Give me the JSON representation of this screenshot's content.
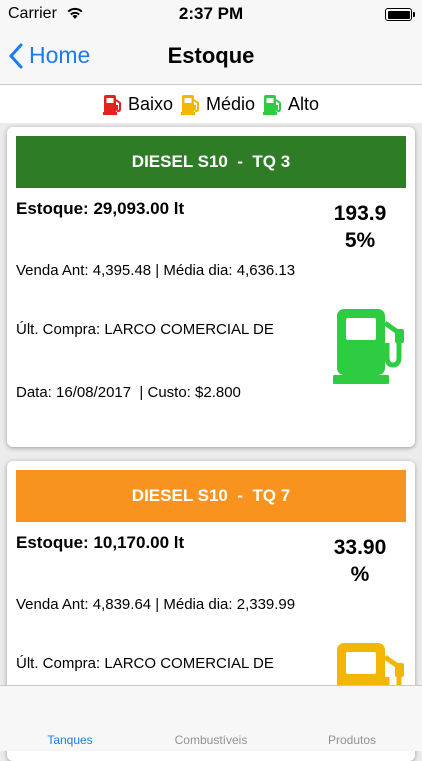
{
  "status_bar": {
    "carrier": "Carrier",
    "time": "2:37 PM",
    "wifi_icon": "wifi-icon",
    "battery_icon": "battery-icon"
  },
  "nav": {
    "back_label": "Home",
    "title": "Estoque",
    "back_icon": "chevron-left-icon"
  },
  "legend": [
    {
      "label": "Baixo",
      "color": "#e0231b",
      "icon": "fuel-pump-icon"
    },
    {
      "label": "Médio",
      "color": "#f2b705",
      "icon": "fuel-pump-icon"
    },
    {
      "label": "Alto",
      "color": "#2ecc40",
      "icon": "fuel-pump-icon"
    }
  ],
  "tanks": [
    {
      "header": "DIESEL S10  -  TQ 3",
      "header_color": "#2e7d26",
      "stock": "Estoque: 29,093.00 lt",
      "percent_line1": "193.9",
      "percent_line2": "5%",
      "sales": "Venda Ant: 4,395.48  | Média dia: 4,636.13",
      "purchase": "Últ. Compra: LARCO COMERCIAL DE",
      "date_cost": "Data: 16/08/2017  | Custo: $2.800",
      "level": "Alto",
      "pump_color": "#2ecc40"
    },
    {
      "header": "DIESEL S10  -  TQ 7",
      "header_color": "#f7931e",
      "stock": "Estoque: 10,170.00 lt",
      "percent_line1": "33.90",
      "percent_line2": "%",
      "sales": "Venda Ant: 4,839.64  | Média dia: 2,339.99",
      "purchase": "Últ. Compra: LARCO COMERCIAL DE",
      "level": "Médio",
      "pump_color": "#f2b705"
    }
  ],
  "tabs": [
    {
      "label": "Tanques",
      "active": true
    },
    {
      "label": "Combustíveis",
      "active": false
    },
    {
      "label": "Produtos",
      "active": false
    }
  ],
  "colors": {
    "accent": "#1a7cf5",
    "inactive_tab": "#929292"
  }
}
